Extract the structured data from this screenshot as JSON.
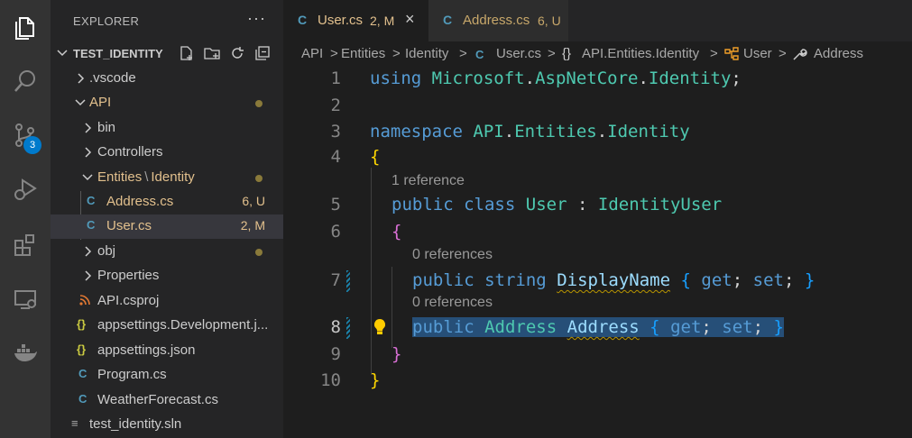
{
  "activity_bar": {
    "scm_badge": "3",
    "items": [
      "explorer-icon",
      "search-icon",
      "source-control-icon",
      "run-debug-icon",
      "extensions-icon",
      "remote-explorer-icon",
      "docker-icon"
    ]
  },
  "sidebar": {
    "title": "EXPLORER",
    "more": "···",
    "project_name": "TEST_IDENTITY",
    "tree": [
      {
        "label": ".vscode"
      },
      {
        "label": "API"
      },
      {
        "label": "bin"
      },
      {
        "label": "Controllers"
      },
      {
        "label": "Entities",
        "label_sep": "\\",
        "label2": "Identity"
      },
      {
        "label": "Address.cs",
        "icon": "C",
        "decoration": "6, U"
      },
      {
        "label": "User.cs",
        "icon": "C",
        "decoration": "2, M"
      },
      {
        "label": "obj"
      },
      {
        "label": "Properties"
      },
      {
        "label": "API.csproj",
        "icon": "rss"
      },
      {
        "label": "appsettings.Development.j...",
        "icon": "{}"
      },
      {
        "label": "appsettings.json",
        "icon": "{}"
      },
      {
        "label": "Program.cs",
        "icon": "C"
      },
      {
        "label": "WeatherForecast.cs",
        "icon": "C"
      },
      {
        "label": "test_identity.sln",
        "icon": "≡"
      }
    ]
  },
  "tabs": [
    {
      "label": "User.cs",
      "decoration": "2, M",
      "icon": "C",
      "close": "×"
    },
    {
      "label": "Address.cs",
      "decoration": "6, U",
      "icon": "C"
    }
  ],
  "breadcrumb": [
    "API",
    "Entities",
    "Identity",
    "User.cs",
    "API.Entities.Identity",
    "User",
    "Address"
  ],
  "breadcrumb_sep": ">",
  "breadcrumb_ns_icon": "{}",
  "code": {
    "line_numbers": [
      "1",
      "2",
      "3",
      "4",
      "5",
      "6",
      "7",
      "8",
      "9",
      "10"
    ],
    "lens": [
      "1 reference",
      "0 references",
      "0 references"
    ],
    "line1": {
      "kw": "using",
      "ns1": "Microsoft",
      "d1": ".",
      "ns2": "AspNetCore",
      "d2": ".",
      "ns3": "Identity",
      "end": ";"
    },
    "line3": {
      "kw": "namespace",
      "ns1": "API",
      "d1": ".",
      "ns2": "Entities",
      "d2": ".",
      "ns3": "Identity"
    },
    "line4": "{",
    "line5": {
      "kw1": "public",
      "kw2": "class",
      "name": "User",
      "colon": ":",
      "base": "IdentityUser"
    },
    "line6": "{",
    "line7": {
      "kw1": "public",
      "kw2": "string",
      "name": "DisplayName",
      "ob": "{",
      "get": "get",
      "semi1": ";",
      "set": "set",
      "semi2": ";",
      "cb": "}"
    },
    "line8": {
      "kw1": "public",
      "type": "Address",
      "name": "Address",
      "ob": "{",
      "get": "get",
      "semi1": ";",
      "set": "set",
      "semi2": ";",
      "cb": "}"
    },
    "line9": "}",
    "line10": "}"
  }
}
